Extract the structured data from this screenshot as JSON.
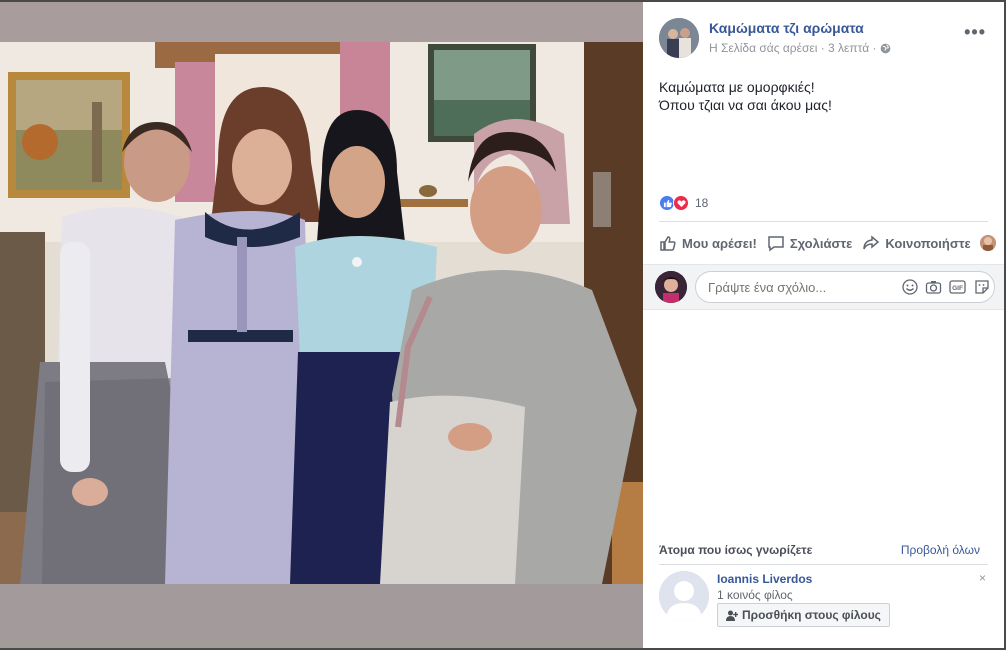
{
  "post": {
    "page_name": "Καμώματα τζι αρώματα",
    "meta": "Η Σελίδα σάς αρέσει · 3 λεπτά · ",
    "privacy_icon": "globe-icon",
    "more_label": "•••",
    "text_line1": "Καμώματα με ομορφκιές!",
    "text_line2": "Όπου τζιαι να σαι άκου μας!"
  },
  "reactions": {
    "count": "18",
    "types": [
      "like-icon",
      "love-icon"
    ],
    "colors": {
      "like": "#4a7df0",
      "love": "#f0284a"
    }
  },
  "actions": {
    "like": "Μου αρέσει!",
    "comment": "Σχολιάστε",
    "share": "Κοινοποιήστε"
  },
  "comment_box": {
    "placeholder": "Γράψτε ένα σχόλιο...",
    "icons": [
      "emoji-icon",
      "camera-icon",
      "gif-icon",
      "sticker-icon"
    ],
    "gif_label": "GIF"
  },
  "people_you_may_know": {
    "title": "Άτομα που ίσως γνωρίζετε",
    "see_all": "Προβολή όλων",
    "person": {
      "name": "Ioannis Liverdos",
      "mutual": "1 κοινός φίλος",
      "add_label": "Προσθήκη στους φίλους",
      "dismiss": "×"
    }
  },
  "colors": {
    "link": "#385898",
    "photo_backdrop": "#a39a9b"
  }
}
